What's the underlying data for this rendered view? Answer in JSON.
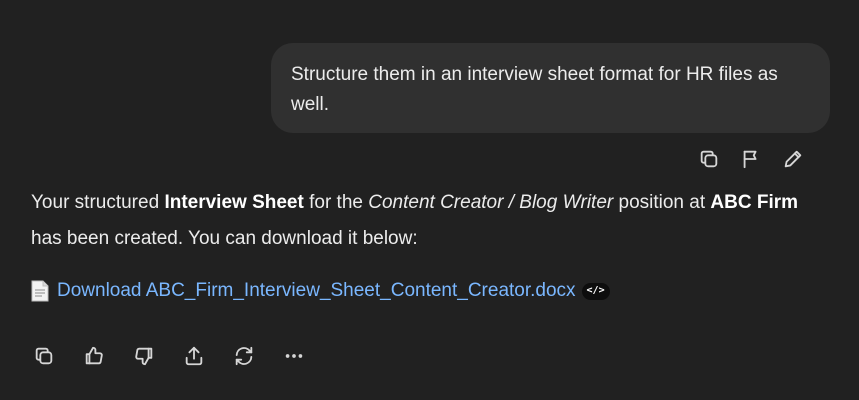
{
  "user_message": {
    "text": "Structure them in an interview sheet format for HR files as well."
  },
  "user_message_actions": {
    "icons": [
      "copy-icon",
      "flag-icon",
      "edit-pencil-icon"
    ]
  },
  "assistant_message": {
    "part1": "Your structured ",
    "bold1": "Interview Sheet",
    "part2": " for the ",
    "italic1": "Content Creator / Blog Writer",
    "part3": " position at ",
    "bold2": "ABC Firm",
    "part4": " has been created. You can download it below:"
  },
  "download": {
    "link_text": "Download ABC_Firm_Interview_Sheet_Content_Creator.docx",
    "badge_text": "</>",
    "link_color": "#7ab7ff"
  },
  "response_actions": {
    "icons": [
      "copy-icon",
      "thumbs-up-icon",
      "thumbs-down-icon",
      "share-icon",
      "regenerate-icon",
      "more-icon"
    ]
  },
  "colors": {
    "background": "#212121",
    "user_bubble": "#303030",
    "text": "#ececec"
  }
}
